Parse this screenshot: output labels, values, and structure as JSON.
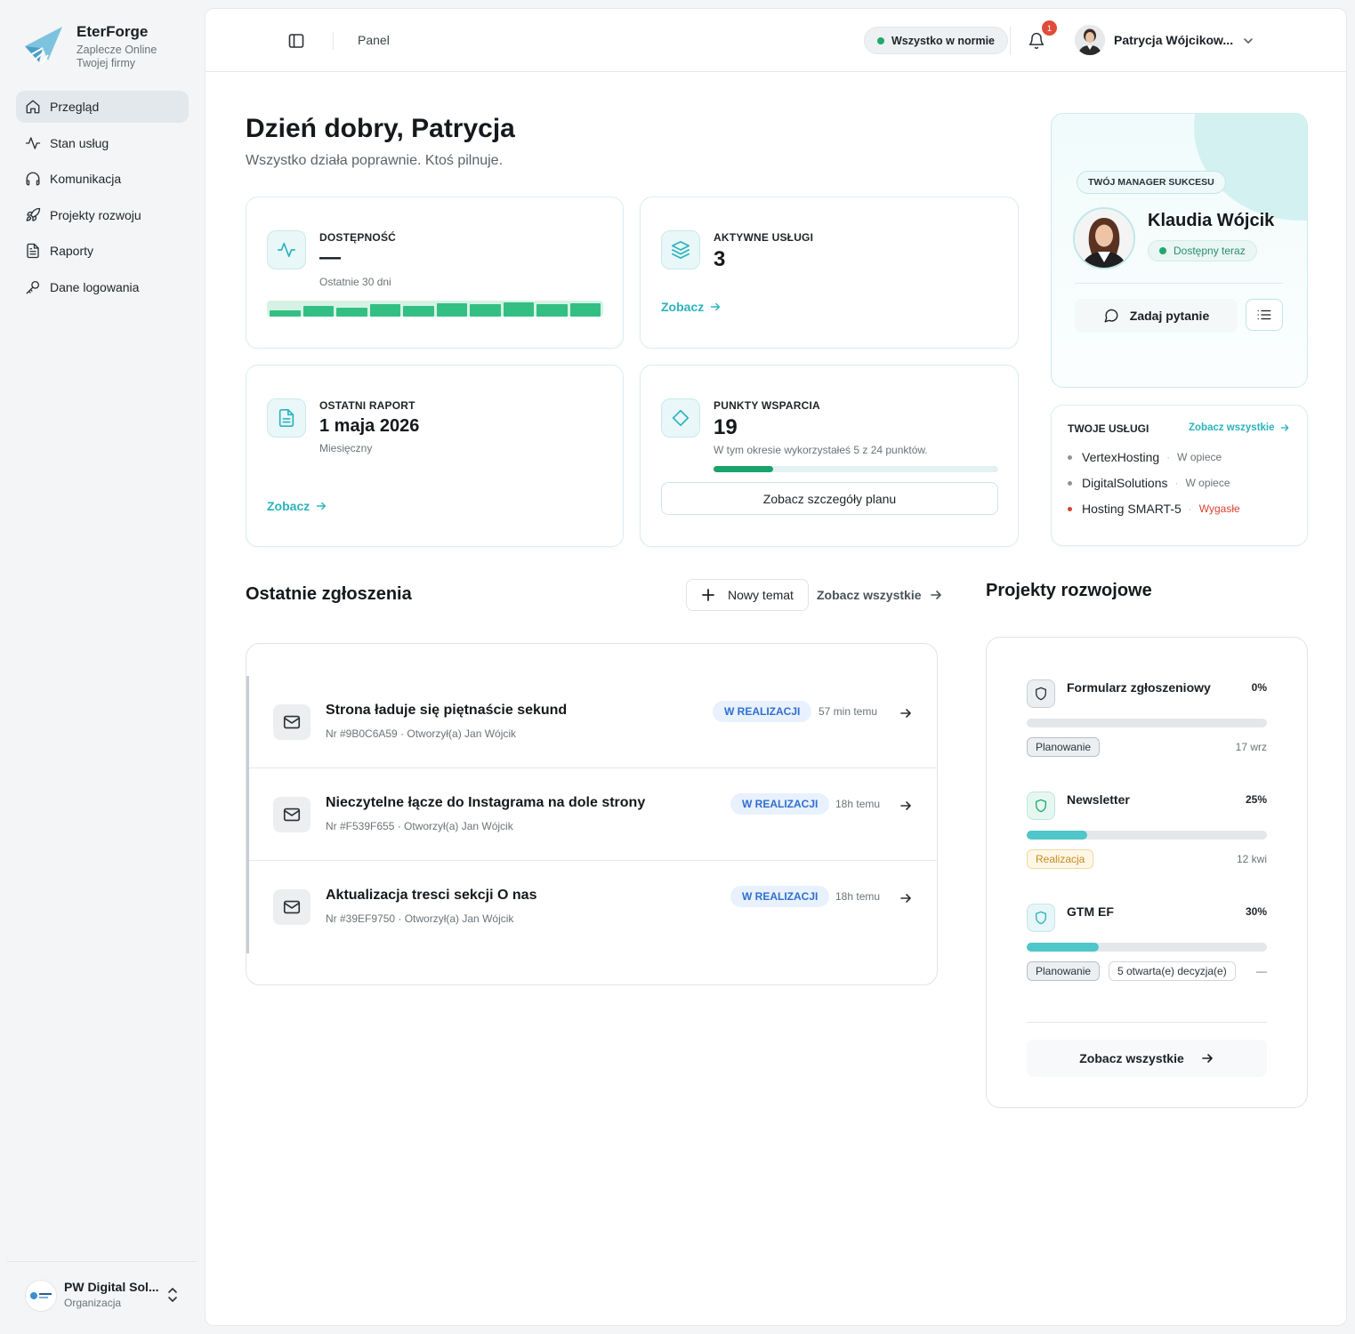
{
  "brand": {
    "name": "EterForge",
    "tagline_1": "Zaplecze Online",
    "tagline_2": "Twojej firmy"
  },
  "sidebar": {
    "items": [
      {
        "label": "Przegląd",
        "icon": "home-icon",
        "active": true
      },
      {
        "label": "Stan usług",
        "icon": "activity-icon"
      },
      {
        "label": "Komunikacja",
        "icon": "headphones-icon"
      },
      {
        "label": "Projekty rozwoju",
        "icon": "rocket-icon"
      },
      {
        "label": "Raporty",
        "icon": "document-icon"
      },
      {
        "label": "Dane logowania",
        "icon": "key-icon"
      }
    ]
  },
  "org": {
    "name": "PW Digital Sol...",
    "label": "Organizacja"
  },
  "topbar": {
    "breadcrumb": "Panel",
    "status": "Wszystko w normie",
    "notifications": "1",
    "user": "Patrycja Wójcikow..."
  },
  "greeting": {
    "title": "Dzień dobry, Patrycja",
    "subtitle": "Wszystko działa poprawnie. Ktoś pilnuje."
  },
  "kpi": {
    "availability": {
      "label": "DOSTĘPNOŚĆ",
      "value": "—",
      "sub": "Ostatnie 30 dni",
      "bars": [
        0.45,
        0.75,
        0.6,
        0.9,
        0.75,
        0.95,
        0.9,
        1.0,
        0.9,
        0.95
      ]
    },
    "services": {
      "label": "AKTYWNE USŁUGI",
      "value": "3",
      "link": "Zobacz"
    },
    "report": {
      "label": "OSTATNI RAPORT",
      "value": "1 maja 2026",
      "sub": "Miesięczny",
      "link": "Zobacz"
    },
    "points": {
      "label": "PUNKTY WSPARCIA",
      "value": "19",
      "sub": "W tym okresie wykorzystałeś 5 z 24 punktów.",
      "used": 5,
      "total": 24,
      "button": "Zobacz szczegóły planu"
    }
  },
  "manager": {
    "tag": "TWÓJ MANAGER SUKCESU",
    "name": "Klaudia Wójcik",
    "status": "Dostępny teraz",
    "ask": "Zadaj pytanie"
  },
  "my_services": {
    "title": "TWOJE USŁUGI",
    "see_all": "Zobacz wszystkie",
    "items": [
      {
        "name": "VertexHosting",
        "state": "W opiece",
        "color": "#8d959a"
      },
      {
        "name": "DigitalSolutions",
        "state": "W opiece",
        "color": "#8d959a"
      },
      {
        "name": "Hosting SMART-5",
        "state": "Wygasłe",
        "color": "#d9412f"
      }
    ]
  },
  "tickets": {
    "title": "Ostatnie zgłoszenia",
    "new_topic": "Nowy temat",
    "see_all": "Zobacz wszystkie",
    "items": [
      {
        "title": "Strona ładuje się piętnaście sekund",
        "meta": "Nr #9B0C6A59 · Otworzył(a) Jan Wójcik",
        "status": "W REALIZACJI",
        "time": "57 min temu"
      },
      {
        "title": "Nieczytelne łącze do Instagrama na dole strony",
        "meta": "Nr #F539F655 · Otworzył(a) Jan Wójcik",
        "status": "W REALIZACJI",
        "time": "18h temu"
      },
      {
        "title": "Aktualizacja tresci sekcji O nas",
        "meta": "Nr #39EF9750 · Otworzył(a) Jan Wójcik",
        "status": "W REALIZACJI",
        "time": "18h temu"
      }
    ]
  },
  "projects": {
    "title": "Projekty rozwojowe",
    "see_all": "Zobacz wszystkie",
    "items": [
      {
        "name": "Formularz zgłoszeniowy",
        "percent": "0%",
        "progress": 0,
        "status": "Planowanie",
        "date": "17 wrz"
      },
      {
        "name": "Newsletter",
        "percent": "25%",
        "progress": 0.25,
        "status": "Realizacja",
        "date": "12 kwi"
      },
      {
        "name": "GTM EF",
        "percent": "30%",
        "progress": 0.3,
        "status": "Planowanie",
        "decisions": "5 otwarta(e) decyzja(e)",
        "date": "—"
      }
    ]
  },
  "colors": {
    "accent": "#2bb3bd",
    "success": "#1faa6b",
    "danger": "#e04b3b",
    "badge_blue": "#2f6fd0"
  }
}
